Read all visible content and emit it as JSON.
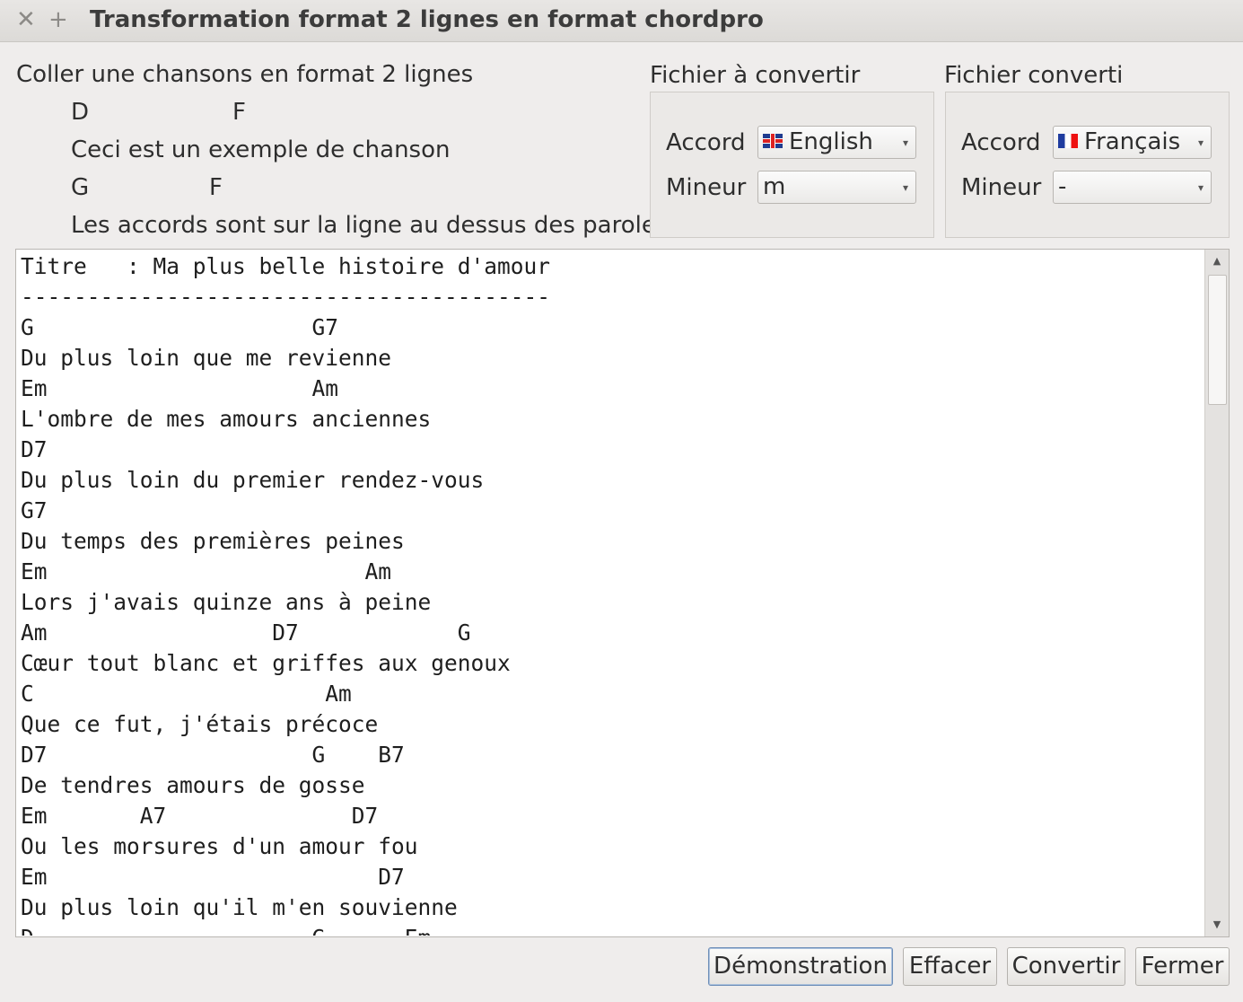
{
  "window": {
    "title": "Transformation format 2 lignes en format chordpro",
    "close_glyph": "✕",
    "maximize_glyph": "+"
  },
  "help": {
    "title": "Coller une chansons en format 2 lignes",
    "example_line1_chord_a": "D",
    "example_line1_chord_b": "F",
    "example_line2": "Ceci est un exemple de chanson",
    "example_line3_chord_a": "G",
    "example_line3_chord_b": "F",
    "example_line4": "Les accords sont sur la ligne au dessus des paroles"
  },
  "source_group": {
    "title": "Fichier  à convertir",
    "accord_label": "Accord",
    "accord_value": "English",
    "accord_flag": "uk-flag-icon",
    "mineur_label": "Mineur",
    "mineur_value": "m"
  },
  "target_group": {
    "title": "Fichier converti",
    "accord_label": "Accord",
    "accord_value": "Français",
    "accord_flag": "fr-flag-icon",
    "mineur_label": "Mineur",
    "mineur_value": "-"
  },
  "editor": {
    "content": "Titre   : Ma plus belle histoire d'amour\n----------------------------------------\nG                     G7\nDu plus loin que me revienne\nEm                    Am\nL'ombre de mes amours anciennes\nD7\nDu plus loin du premier rendez-vous\nG7\nDu temps des premières peines\nEm                        Am\nLors j'avais quinze ans à peine\nAm                 D7            G\nCœur tout blanc et griffes aux genoux\nC                      Am\nQue ce fut, j'étais précoce\nD7                    G    B7\nDe tendres amours de gosse\nEm       A7              D7\nOu les morsures d'un amour fou\nEm                         D7\nDu plus loin qu'il m'en souvienne\nD                     G      Em"
  },
  "buttons": {
    "demo": "Démonstration",
    "clear": "Effacer",
    "convert": "Convertir",
    "close": "Fermer"
  }
}
